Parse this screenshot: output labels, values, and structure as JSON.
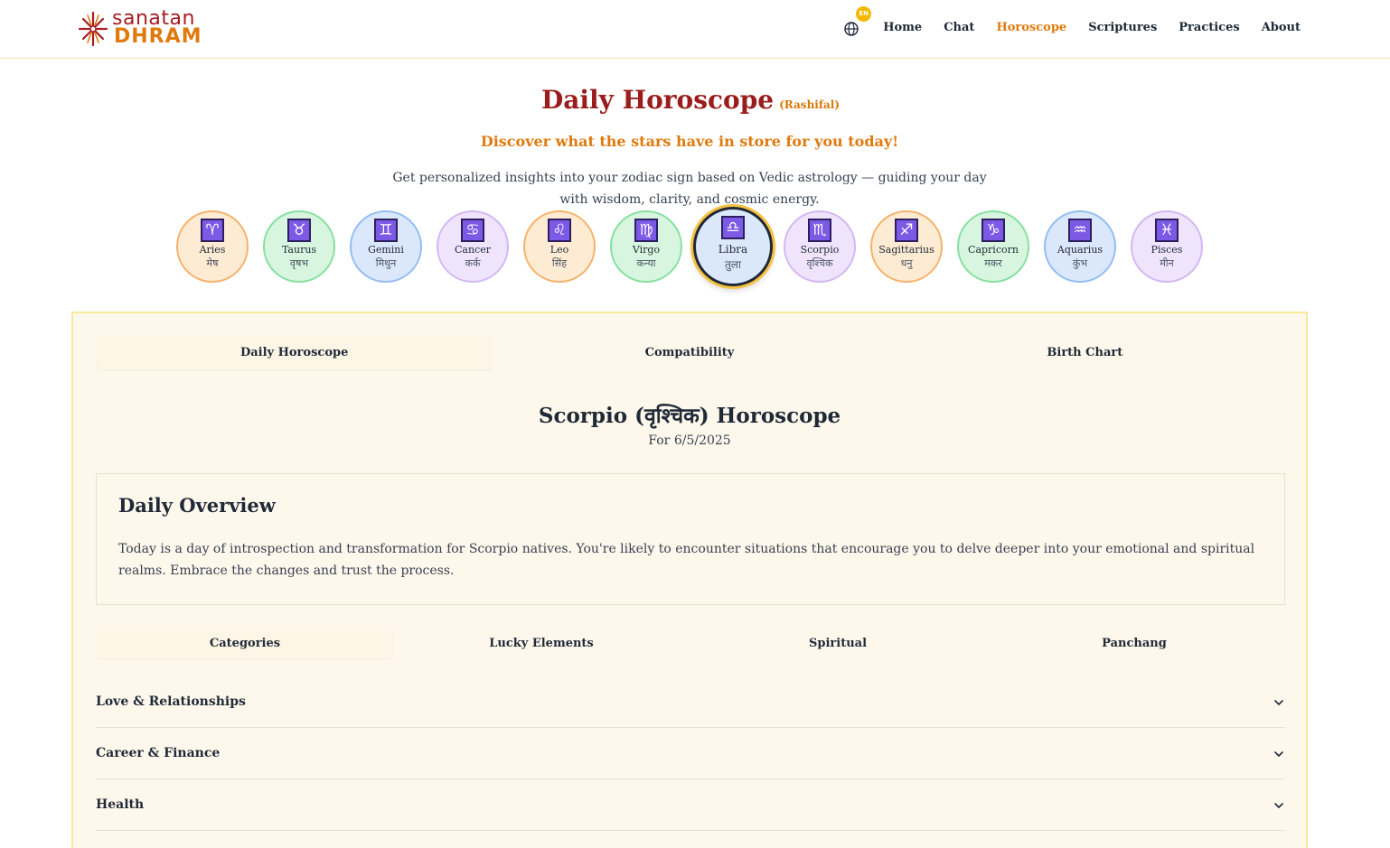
{
  "brand": {
    "line1": "sanatan",
    "line2": "DHRAM"
  },
  "nav": {
    "lang_badge": "EN",
    "items": [
      {
        "label": "Home",
        "active": false
      },
      {
        "label": "Chat",
        "active": false
      },
      {
        "label": "Horoscope",
        "active": true
      },
      {
        "label": "Scriptures",
        "active": false
      },
      {
        "label": "Practices",
        "active": false
      },
      {
        "label": "About",
        "active": false
      }
    ]
  },
  "hero": {
    "title": "Daily Horoscope",
    "title_sub": "(Rashifal)",
    "tagline": "Discover what the stars have in store for you today!",
    "description": "Get personalized insights into your zodiac sign based on Vedic astrology — guiding your day with wisdom, clarity, and cosmic energy."
  },
  "zodiac": [
    {
      "en": "Aries",
      "hi": "मेष",
      "symbol": "♈",
      "color": "orange"
    },
    {
      "en": "Taurus",
      "hi": "वृषभ",
      "symbol": "♉",
      "color": "green"
    },
    {
      "en": "Gemini",
      "hi": "मिथुन",
      "symbol": "♊",
      "color": "blue"
    },
    {
      "en": "Cancer",
      "hi": "कर्क",
      "symbol": "♋",
      "color": "purple"
    },
    {
      "en": "Leo",
      "hi": "सिंह",
      "symbol": "♌",
      "color": "orange"
    },
    {
      "en": "Virgo",
      "hi": "कन्या",
      "symbol": "♍",
      "color": "green"
    },
    {
      "en": "Libra",
      "hi": "तुला",
      "symbol": "♎",
      "color": "blue",
      "selected": true
    },
    {
      "en": "Scorpio",
      "hi": "वृश्चिक",
      "symbol": "♏",
      "color": "purple"
    },
    {
      "en": "Sagittarius",
      "hi": "धनु",
      "symbol": "♐",
      "color": "orange"
    },
    {
      "en": "Capricorn",
      "hi": "मकर",
      "symbol": "♑",
      "color": "green"
    },
    {
      "en": "Aquarius",
      "hi": "कुंभ",
      "symbol": "♒",
      "color": "blue"
    },
    {
      "en": "Pisces",
      "hi": "मीन",
      "symbol": "♓",
      "color": "purple"
    }
  ],
  "tabs": [
    "Daily Horoscope",
    "Compatibility",
    "Birth Chart"
  ],
  "reading": {
    "title": "Scorpio (वृश्चिक) Horoscope",
    "date": "For 6/5/2025",
    "overview_heading": "Daily Overview",
    "overview_text": "Today is a day of introspection and transformation for Scorpio natives. You're likely to encounter situations that encourage you to delve deeper into your emotional and spiritual realms. Embrace the changes and trust the process."
  },
  "subtabs": [
    "Categories",
    "Lucky Elements",
    "Spiritual",
    "Panchang"
  ],
  "accordion": [
    "Love & Relationships",
    "Career & Finance",
    "Health"
  ],
  "colors": {
    "accent": "#e07a0e",
    "brand_red": "#9b1c1c",
    "panel_bg": "#fef8ec"
  }
}
